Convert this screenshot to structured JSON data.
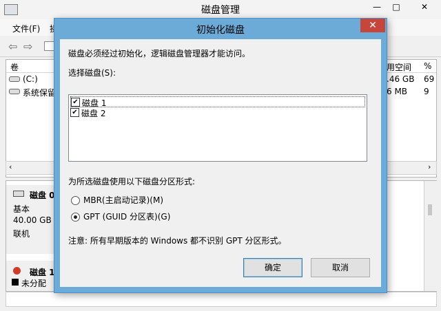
{
  "main_window": {
    "title": "磁盘管理",
    "controls": {
      "minimize": "—",
      "maximize": "□",
      "close": "✕"
    },
    "menu": [
      "文件(F)",
      "操"
    ],
    "volume_list": {
      "headers": {
        "volume": "卷",
        "free_space": "用空间",
        "percent": "%"
      },
      "rows": [
        {
          "name": "(C:)",
          "free": ".46 GB",
          "pct": "69"
        },
        {
          "name": "系统保留",
          "free": "6 MB",
          "pct": "9"
        }
      ]
    },
    "disks": [
      {
        "name": "磁盘 0",
        "type": "基本",
        "size": "40.00 GB",
        "status": "联机"
      },
      {
        "name": "磁盘 1",
        "legend_unallocated": "未分配"
      }
    ]
  },
  "dialog": {
    "title": "初始化磁盘",
    "close": "✕",
    "message": "磁盘必须经过初始化，逻辑磁盘管理器才能访问。",
    "select_label": "选择磁盘(S):",
    "disks": [
      {
        "label": "磁盘 1",
        "checked": "✔"
      },
      {
        "label": "磁盘 2",
        "checked": "✔"
      }
    ],
    "partition_label": "为所选磁盘使用以下磁盘分区形式:",
    "options": [
      {
        "label": "MBR(主启动记录)(M)",
        "selected": false
      },
      {
        "label": "GPT (GUID 分区表)(G)",
        "selected": true
      }
    ],
    "note": "注意: 所有早期版本的 Windows 都不识别 GPT 分区形式。",
    "ok": "确定",
    "cancel": "取消"
  }
}
